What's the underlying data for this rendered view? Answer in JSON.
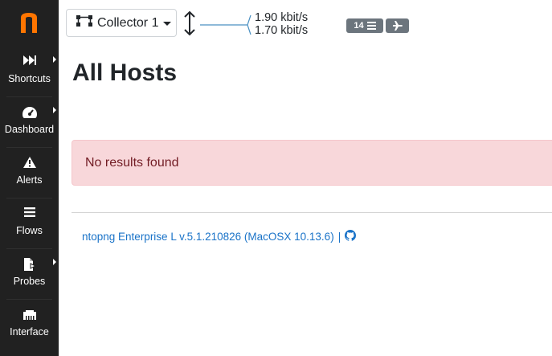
{
  "sidebar": {
    "logo_letter": "n",
    "items": [
      {
        "label": "Shortcuts",
        "icon": "fast-forward-icon",
        "has_submenu": true
      },
      {
        "label": "Dashboard",
        "icon": "gauge-icon",
        "has_submenu": true
      },
      {
        "label": "Alerts",
        "icon": "warning-icon",
        "has_submenu": false
      },
      {
        "label": "Flows",
        "icon": "bars-icon",
        "has_submenu": false
      },
      {
        "label": "Probes",
        "icon": "file-export-icon",
        "has_submenu": true
      },
      {
        "label": "Interface",
        "icon": "ethernet-icon",
        "has_submenu": false
      }
    ]
  },
  "topbar": {
    "collector_label": "Collector 1",
    "rate_up": "1.90 kbit/s",
    "rate_down": "1.70 kbit/s",
    "flows_badge": "14"
  },
  "main": {
    "title": "All Hosts",
    "alert_text": "No results found"
  },
  "footer": {
    "version_text": "ntopng Enterprise L v.5.1.210826 (MacOSX 10.13.6)",
    "separator": "|"
  },
  "colors": {
    "sidebar_bg": "#212121",
    "logo_orange": "#ff7500",
    "alert_bg": "#f8d7da",
    "alert_text": "#721c24",
    "link": "#1a73c8",
    "badge": "#6c757d"
  }
}
